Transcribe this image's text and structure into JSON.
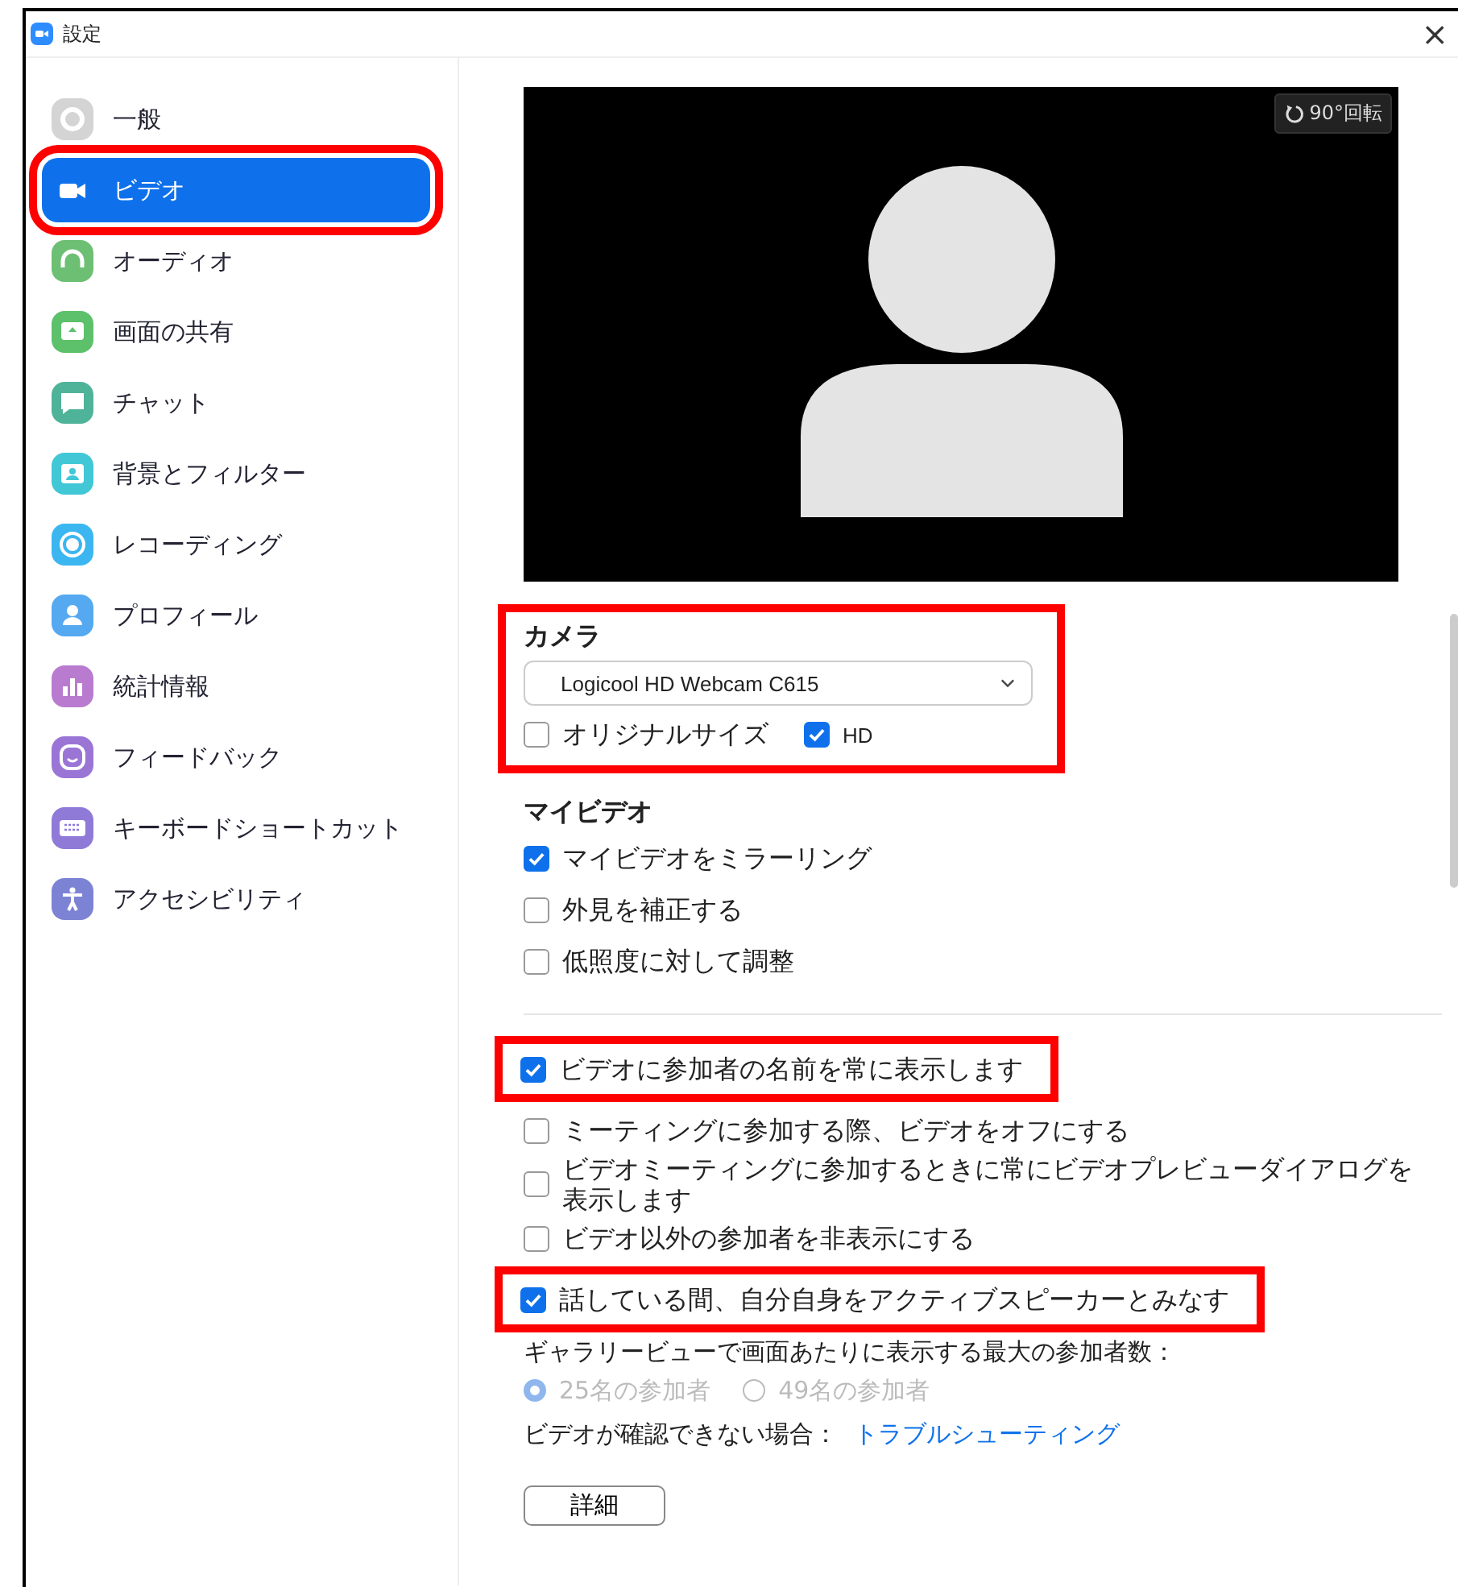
{
  "window": {
    "title": "設定",
    "close": "×"
  },
  "sidebar": {
    "items": [
      {
        "label": "一般",
        "color": "#d4d4d4",
        "selected": false,
        "highlighted": false
      },
      {
        "label": "ビデオ",
        "color": "#0e71eb",
        "selected": true,
        "highlighted": true
      },
      {
        "label": "オーディオ",
        "color": "#6dbf73",
        "selected": false,
        "highlighted": false
      },
      {
        "label": "画面の共有",
        "color": "#5cc16a",
        "selected": false,
        "highlighted": false
      },
      {
        "label": "チャット",
        "color": "#4fb39a",
        "selected": false,
        "highlighted": false
      },
      {
        "label": "背景とフィルター",
        "color": "#41c7d6",
        "selected": false,
        "highlighted": false
      },
      {
        "label": "レコーディング",
        "color": "#3cb6f0",
        "selected": false,
        "highlighted": false
      },
      {
        "label": "プロフィール",
        "color": "#55a9f0",
        "selected": false,
        "highlighted": false
      },
      {
        "label": "統計情報",
        "color": "#b97bcf",
        "selected": false,
        "highlighted": false
      },
      {
        "label": "フィードバック",
        "color": "#9a75d6",
        "selected": false,
        "highlighted": false
      },
      {
        "label": "キーボードショートカット",
        "color": "#8f7ad8",
        "selected": false,
        "highlighted": false
      },
      {
        "label": "アクセシビリティ",
        "color": "#7c83d4",
        "selected": false,
        "highlighted": false
      }
    ]
  },
  "preview": {
    "rotate_button": "90°回転"
  },
  "camera": {
    "heading": "カメラ",
    "highlighted": true,
    "device": "Logicool HD Webcam C615",
    "options": [
      {
        "label": "オリジナルサイズ",
        "checked": false
      },
      {
        "label": "HD",
        "checked": true
      }
    ]
  },
  "my_video": {
    "heading": "マイビデオ",
    "options": [
      {
        "label": "マイビデオをミラーリング",
        "checked": true
      },
      {
        "label": "外見を補正する",
        "checked": false
      },
      {
        "label": "低照度に対して調整",
        "checked": false
      }
    ]
  },
  "options": [
    {
      "label": "ビデオに参加者の名前を常に表示します",
      "checked": true,
      "highlighted": true
    },
    {
      "label": "ミーティングに参加する際、ビデオをオフにする",
      "checked": false,
      "highlighted": false
    },
    {
      "label": "ビデオミーティングに参加するときに常にビデオプレビューダイアログを表示します",
      "checked": false,
      "highlighted": false
    },
    {
      "label": "ビデオ以外の参加者を非表示にする",
      "checked": false,
      "highlighted": false
    },
    {
      "label": "話している間、自分自身をアクティブスピーカーとみなす",
      "checked": true,
      "highlighted": true
    }
  ],
  "gallery": {
    "label": "ギャラリービューで画面あたりに表示する最大の参加者数：",
    "disabled": true,
    "choices": [
      {
        "label": "25名の参加者",
        "selected": true
      },
      {
        "label": "49名の参加者",
        "selected": false
      }
    ]
  },
  "troubleshoot": {
    "label": "ビデオが確認できない場合：",
    "link": "トラブルシューティング"
  },
  "details_button": "詳細"
}
